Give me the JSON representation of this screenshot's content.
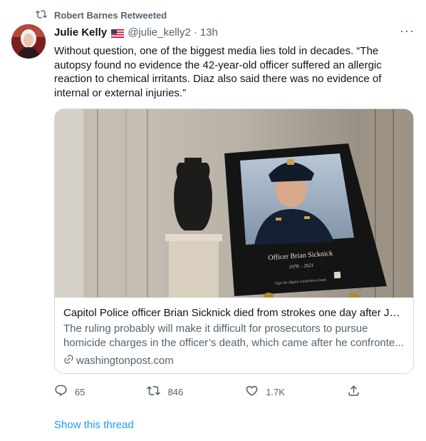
{
  "retweet_banner": {
    "label": "Robert Barnes Retweeted",
    "icon": "retweet-icon"
  },
  "tweet": {
    "author_name": "Julie Kelly",
    "flag_icon": "us-flag-icon",
    "handle": "@julie_kelly2",
    "separator": "·",
    "time": "13h",
    "more_label": "···",
    "text": "Without question, one of the biggest media lies told in decades. “The autopsy found no evidence the 42-year-old officer suffered an allergic reaction to chemical irritants. Diaz also said there was no evidence of internal or external injuries.”"
  },
  "card": {
    "image_caption_name": "Officer Brian Sicknick",
    "image_caption_years": "1978 – 2021",
    "image_caption_footer": "Sign the digital condolence book",
    "title": "Capitol Police officer Brian Sicknick died from strokes one day after Jan...",
    "description": "The ruling probably will make it difficult for prosecutors to pursue homicide charges in the officer’s death, which came after he confronte...",
    "domain": "washingtonpost.com"
  },
  "actions": {
    "reply_count": "65",
    "retweet_count": "846",
    "like_count": "1.7K"
  },
  "show_thread_label": "Show this thread",
  "colors": {
    "accent": "#1d9bf0",
    "secondary_text": "#536471",
    "border": "#cfd9de"
  }
}
